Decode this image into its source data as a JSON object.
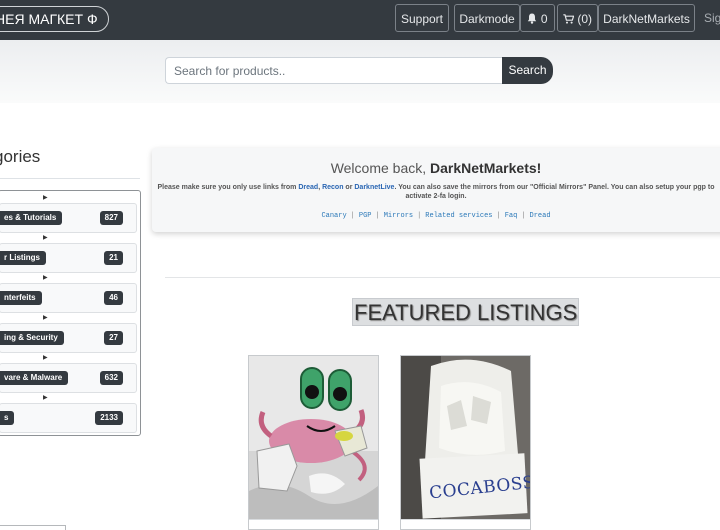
{
  "navbar": {
    "brand": "НЕЯ МАГКЕТ Ф",
    "support_label": "Support",
    "darkmode_label": "Darkmode",
    "notifications_count": "0",
    "cart_label": "(0)",
    "username": "DarkNetMarkets",
    "signout_partial": "Sig"
  },
  "search": {
    "placeholder": "Search for products..",
    "button_label": "Search"
  },
  "categories": {
    "title": "gories",
    "items": [
      {
        "label": "es & Tutorials",
        "count": "827"
      },
      {
        "label": "r Listings",
        "count": "21"
      },
      {
        "label": "nterfeits",
        "count": "46"
      },
      {
        "label": "ing & Security",
        "count": "27"
      },
      {
        "label": "vare & Malware",
        "count": "632"
      },
      {
        "label": "s",
        "count": "2133"
      }
    ]
  },
  "welcome": {
    "greeting": "Welcome back,",
    "username": "DarkNetMarkets!",
    "notice_prefix": "Please make sure you only use links from ",
    "link_dread": "Dread",
    "sep1": ", ",
    "link_recon": "Recon",
    "sep2": " or ",
    "link_darknetlive": "DarknetLive",
    "notice_suffix": ". You can also save the mirrors from our \"Official Mirrors\" Panel. You can also setup your pgp to activate 2-fa login.",
    "links": [
      "Canary",
      "PGP",
      "Mirrors",
      "Related services",
      "Faq",
      "Dread"
    ]
  },
  "featured": {
    "title": "FEATURED LISTINGS",
    "cards": [
      {
        "image": "cartoon-crab-with-product"
      },
      {
        "image": "product-bag-with-cocaboss-note",
        "note_text": "COCABOSS"
      }
    ]
  },
  "colors": {
    "navbar": "#343a40",
    "link": "#2a78b8",
    "badge": "#343a40"
  }
}
